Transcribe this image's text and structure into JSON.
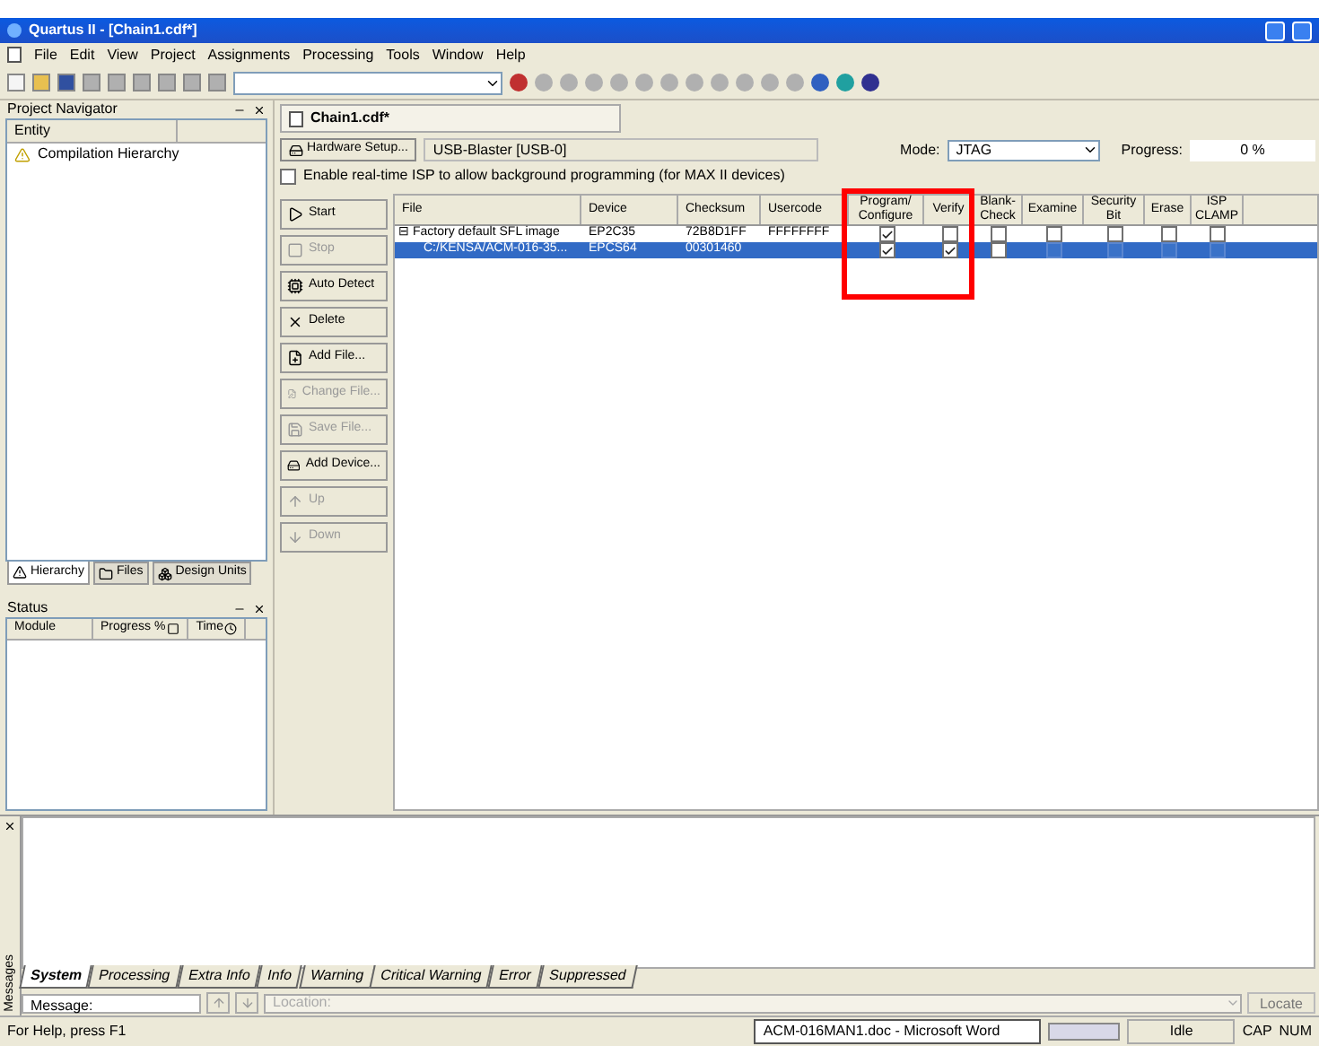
{
  "window": {
    "title": "Quartus II - [Chain1.cdf*]"
  },
  "menu": [
    "File",
    "Edit",
    "View",
    "Project",
    "Assignments",
    "Processing",
    "Tools",
    "Window",
    "Help"
  ],
  "project_navigator": {
    "title": "Project Navigator",
    "column": "Entity",
    "items": [
      "Compilation Hierarchy"
    ],
    "tabs": [
      {
        "label": "Hierarchy",
        "selected": true
      },
      {
        "label": "Files",
        "selected": false
      },
      {
        "label": "Design Units",
        "selected": false
      }
    ]
  },
  "status_panel": {
    "title": "Status",
    "columns": [
      "Module",
      "Progress %",
      "Time"
    ]
  },
  "document_tab": "Chain1.cdf*",
  "hardware": {
    "button": "Hardware Setup...",
    "value": "USB-Blaster [USB-0]",
    "mode_label": "Mode:",
    "mode": "JTAG",
    "progress_label": "Progress:",
    "progress": "0 %"
  },
  "realtime_isp": {
    "label": "Enable real-time ISP to allow background programming (for MAX II devices)",
    "checked": false
  },
  "actions": [
    {
      "label": "Start",
      "disabled": false
    },
    {
      "label": "Stop",
      "disabled": true
    },
    {
      "label": "Auto Detect",
      "disabled": false
    },
    {
      "label": "Delete",
      "disabled": false
    },
    {
      "label": "Add File...",
      "disabled": false
    },
    {
      "label": "Change File...",
      "disabled": true
    },
    {
      "label": "Save File...",
      "disabled": true
    },
    {
      "label": "Add Device...",
      "disabled": false
    },
    {
      "label": "Up",
      "disabled": true
    },
    {
      "label": "Down",
      "disabled": true
    }
  ],
  "table": {
    "columns": [
      "File",
      "Device",
      "Checksum",
      "Usercode",
      "Program/ Configure",
      "Verify",
      "Blank- Check",
      "Examine",
      "Security Bit",
      "Erase",
      "ISP CLAMP"
    ],
    "rows": [
      {
        "file": "Factory default SFL image",
        "expander": "⊟",
        "device": "EP2C35",
        "checksum": "72B8D1FF",
        "usercode": "FFFFFFFF",
        "selected": false,
        "options": [
          {
            "checked": true,
            "disabled": false
          },
          {
            "checked": false,
            "disabled": false
          },
          {
            "checked": false,
            "disabled": false
          },
          {
            "checked": false,
            "disabled": false
          },
          {
            "checked": false,
            "disabled": false
          },
          {
            "checked": false,
            "disabled": false
          },
          {
            "checked": false,
            "disabled": false
          }
        ]
      },
      {
        "file": "C:/KENSA/ACM-016-35...",
        "expander": "",
        "device": "EPCS64",
        "checksum": "00301460",
        "usercode": "",
        "selected": true,
        "options": [
          {
            "checked": true,
            "disabled": false
          },
          {
            "checked": true,
            "disabled": false
          },
          {
            "checked": false,
            "disabled": false
          },
          {
            "checked": false,
            "disabled": true
          },
          {
            "checked": false,
            "disabled": true
          },
          {
            "checked": false,
            "disabled": true
          },
          {
            "checked": false,
            "disabled": true
          }
        ]
      }
    ]
  },
  "messages": {
    "tabs": [
      {
        "label": "System",
        "selected": true
      },
      {
        "label": "Processing",
        "selected": false
      },
      {
        "label": "Extra Info",
        "selected": false
      },
      {
        "label": "Info",
        "selected": false
      },
      {
        "label": "Warning",
        "selected": false
      },
      {
        "label": "Critical Warning",
        "selected": false
      },
      {
        "label": "Error",
        "selected": false
      },
      {
        "label": "Suppressed",
        "selected": false
      }
    ],
    "side_label": "Messages",
    "message_label": "Message:",
    "location_placeholder": "Location:",
    "locate": "Locate"
  },
  "status_bar": {
    "help": "For Help, press F1",
    "task": "ACM-016MAN1.doc - Microsoft Word",
    "state": "Idle",
    "caps": "CAP",
    "num": "NUM"
  }
}
